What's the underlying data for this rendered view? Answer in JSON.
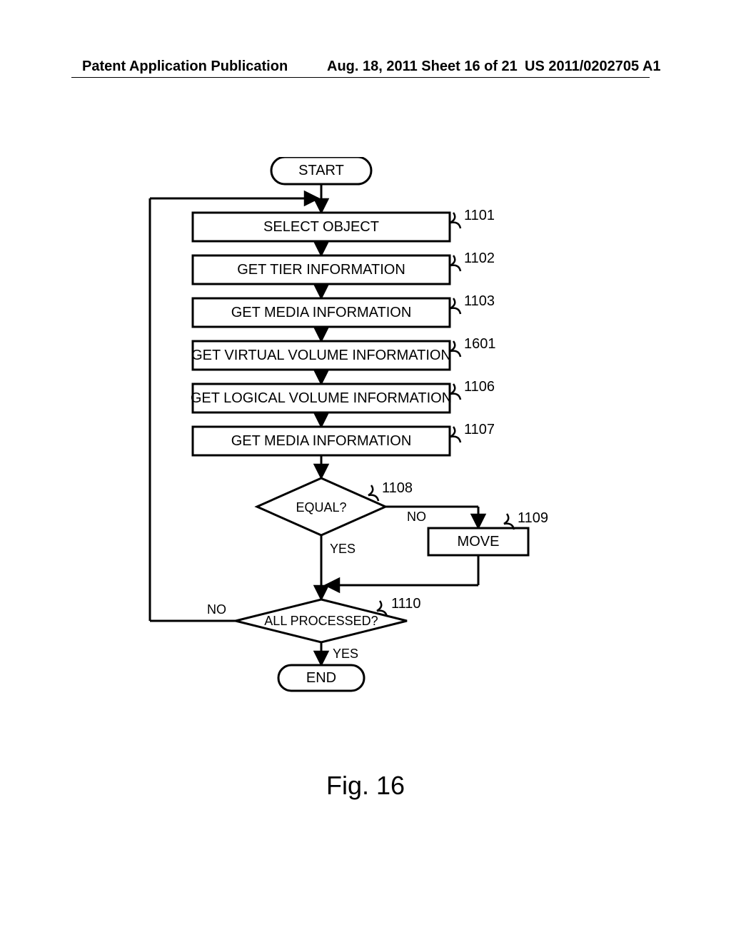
{
  "header": {
    "left": "Patent Application Publication",
    "mid": "Aug. 18, 2011  Sheet 16 of 21",
    "right": "US 2011/0202705 A1"
  },
  "figure_caption": "Fig. 16",
  "terminals": {
    "start": "START",
    "end": "END"
  },
  "steps": {
    "s1": "SELECT OBJECT",
    "s2": "GET TIER INFORMATION",
    "s3": "GET MEDIA INFORMATION",
    "s4": "GET VIRTUAL VOLUME INFORMATION",
    "s5": "GET LOGICAL VOLUME INFORMATION",
    "s6": "GET MEDIA INFORMATION",
    "move": "MOVE"
  },
  "decisions": {
    "d1": "EQUAL?",
    "d2": "ALL PROCESSED?"
  },
  "labels": {
    "yes": "YES",
    "no": "NO"
  },
  "refs": {
    "r1": "1101",
    "r2": "1102",
    "r3": "1103",
    "r4": "1601",
    "r5": "1106",
    "r6": "1107",
    "r7": "1108",
    "r8": "1109",
    "r9": "1110"
  }
}
